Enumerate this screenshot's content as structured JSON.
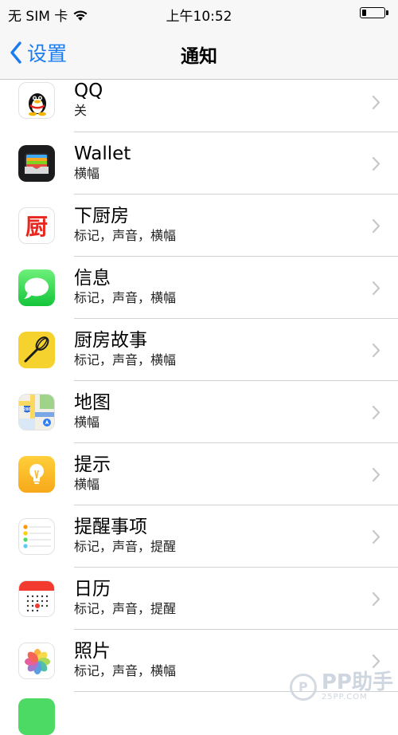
{
  "status_bar": {
    "carrier": "无 SIM 卡",
    "time": "上午10:52",
    "battery_level": 0.2
  },
  "nav": {
    "back_label": "设置",
    "title": "通知"
  },
  "apps": [
    {
      "name": "QQ",
      "subtitle": "关",
      "icon": "qq-icon"
    },
    {
      "name": "Wallet",
      "subtitle": "横幅",
      "icon": "wallet-icon"
    },
    {
      "name": "下厨房",
      "subtitle": "标记，声音，横幅",
      "icon": "xiachufang-icon",
      "icon_glyph": "厨"
    },
    {
      "name": "信息",
      "subtitle": "标记，声音，横幅",
      "icon": "messages-icon"
    },
    {
      "name": "厨房故事",
      "subtitle": "标记，声音，横幅",
      "icon": "kitchen-stories-icon"
    },
    {
      "name": "地图",
      "subtitle": "横幅",
      "icon": "maps-icon",
      "icon_glyph": "280"
    },
    {
      "name": "提示",
      "subtitle": "横幅",
      "icon": "tips-icon"
    },
    {
      "name": "提醒事项",
      "subtitle": "标记，声音，提醒",
      "icon": "reminders-icon"
    },
    {
      "name": "日历",
      "subtitle": "标记，声音，提醒",
      "icon": "calendar-icon"
    },
    {
      "name": "照片",
      "subtitle": "标记，声音，横幅",
      "icon": "photos-icon"
    }
  ],
  "watermark": {
    "logo": "P",
    "text": "PP助手",
    "url": "25PP.COM"
  },
  "colors": {
    "accent": "#1a7cf0",
    "separator": "#d1d1d6",
    "bar_bg": "#f7f7f7"
  }
}
